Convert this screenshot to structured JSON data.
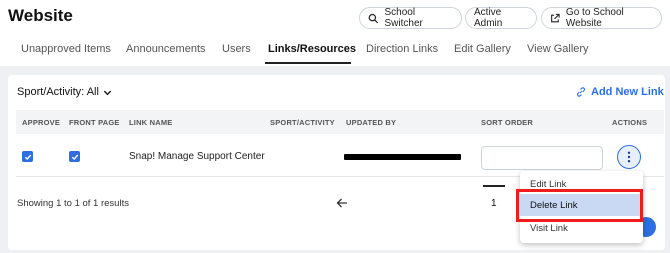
{
  "header": {
    "title": "Website",
    "buttons": {
      "school_switcher": "School Switcher",
      "active_admin": "Active Admin",
      "go_to_site": "Go to School Website"
    }
  },
  "tabs": [
    {
      "label": "Unapproved Items"
    },
    {
      "label": "Announcements"
    },
    {
      "label": "Users"
    },
    {
      "label": "Links/Resources",
      "active": true
    },
    {
      "label": "Direction Links"
    },
    {
      "label": "Edit Gallery"
    },
    {
      "label": "View Gallery"
    }
  ],
  "toolbar": {
    "filter_label": "Sport/Activity: All",
    "add_link_label": "Add New Link"
  },
  "table": {
    "columns": [
      "APPROVE",
      "FRONT PAGE",
      "LINK NAME",
      "SPORT/ACTIVITY",
      "UPDATED BY",
      "SORT ORDER",
      "ACTIONS"
    ],
    "rows": [
      {
        "approve": true,
        "front_page": true,
        "link_name": "Snap! Manage Support Center",
        "sport_activity": "",
        "updated_by": "",
        "sort_order": ""
      }
    ]
  },
  "pagination": {
    "summary": "Showing 1 to 1 of 1 results",
    "current_page": "1"
  },
  "actions_menu": {
    "items": [
      "Edit Link",
      "Delete Link",
      "Visit Link"
    ],
    "highlighted": "Delete Link"
  },
  "colors": {
    "accent": "#2d6ee0",
    "highlight": "#ee1c1c"
  }
}
